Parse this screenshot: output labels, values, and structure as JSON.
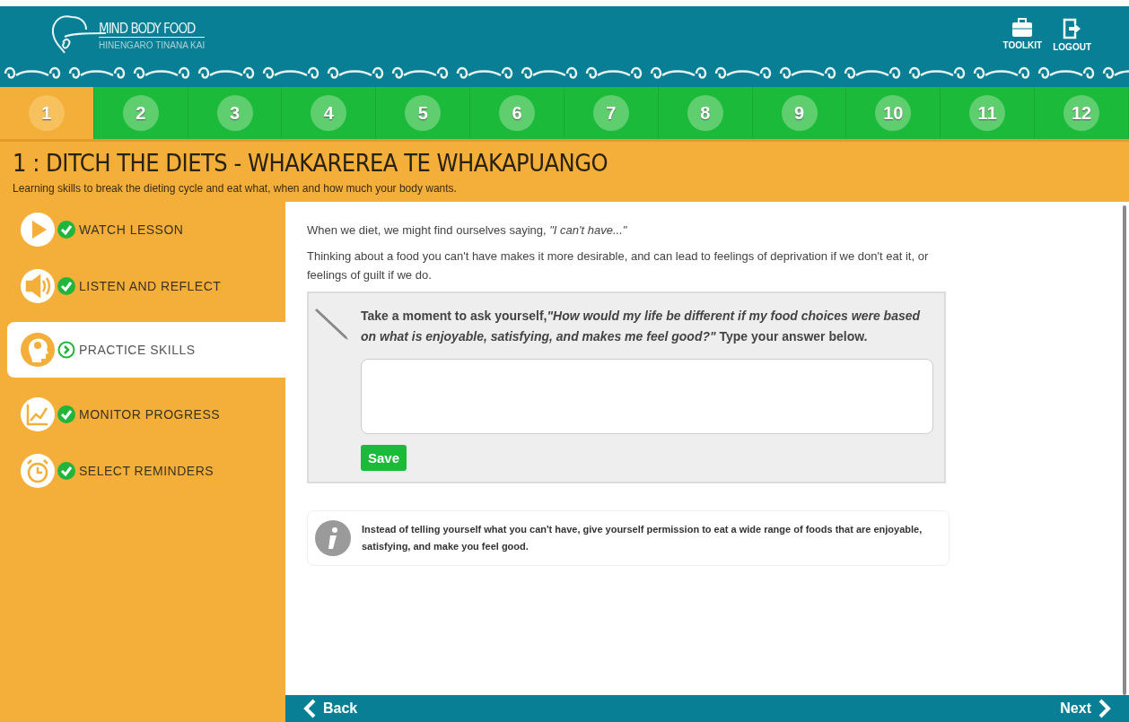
{
  "header": {
    "logo_title": "MIND BODY FOOD",
    "logo_subtitle": "HINENGARO TINANA KAI",
    "actions": [
      {
        "kind": "toolkit",
        "label": "TOOLKIT"
      },
      {
        "kind": "logout",
        "label": "LOGOUT"
      }
    ]
  },
  "steps": [
    {
      "label": "1",
      "selected": true
    },
    {
      "label": "2",
      "selected": false
    },
    {
      "label": "3",
      "selected": false
    },
    {
      "label": "4",
      "selected": false
    },
    {
      "label": "5",
      "selected": false
    },
    {
      "label": "6",
      "selected": false
    },
    {
      "label": "7",
      "selected": false
    },
    {
      "label": "8",
      "selected": false
    },
    {
      "label": "9",
      "selected": false
    },
    {
      "label": "10",
      "selected": false
    },
    {
      "label": "11",
      "selected": false
    },
    {
      "label": "12",
      "selected": false
    }
  ],
  "lesson": {
    "title": "1 : DITCH THE DIETS - WHAKAREREA TE WHAKAPUANGO",
    "subtitle": "Learning skills to break the dieting cycle and eat what, when and how much your body wants."
  },
  "sidebar": {
    "items": [
      {
        "kind": "play",
        "label": "WATCH LESSON",
        "completed": true,
        "selected": false
      },
      {
        "kind": "speaker",
        "label": "LISTEN AND REFLECT",
        "completed": true,
        "selected": false
      },
      {
        "kind": "head",
        "label": "PRACTICE SKILLS",
        "completed": false,
        "selected": true
      },
      {
        "kind": "chart",
        "label": "MONITOR PROGRESS",
        "completed": true,
        "selected": false
      },
      {
        "kind": "clock",
        "label": "SELECT REMINDERS",
        "completed": true,
        "selected": false
      }
    ]
  },
  "content": {
    "paragraphs": [
      "When we diet, we might find ourselves saying, *\"I can't have...\"*",
      "Thinking about a food you can't have makes it more desirable, and can lead to feelings of deprivation if we don't eat it, or feelings of guilt if we do."
    ],
    "exercise": {
      "prompt": "Take a moment to ask yourself,*\"How would my life be different if my food choices were based on what is enjoyable, satisfying, and makes me feel good?\"* Type your answer below.",
      "save_button": "Save"
    },
    "tip": "Instead of telling yourself what you can't have, give yourself permission to eat a wide range of foods that are enjoyable, satisfying, and make you feel good."
  },
  "footer": {
    "back": "Back",
    "next": "Next"
  }
}
